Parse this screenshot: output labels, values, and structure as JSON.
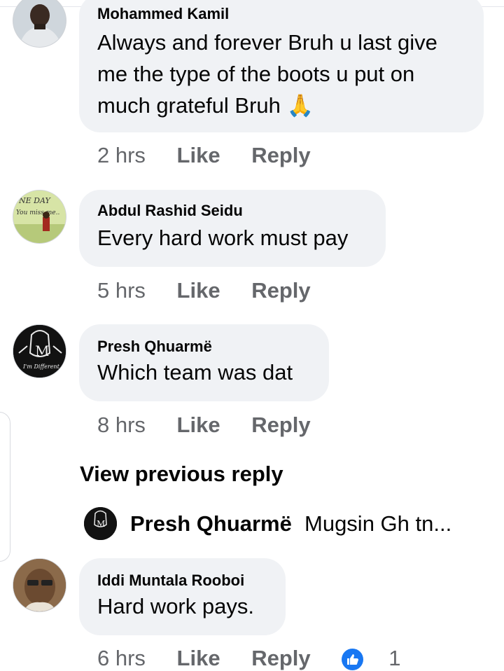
{
  "comments": [
    {
      "author": "Mohammed Kamil",
      "text": "Always and forever Bruh u last give me the type of the boots u put on much grateful Bruh 🙏",
      "time": "2 hrs",
      "like": "Like",
      "reply": "Reply"
    },
    {
      "author": "Abdul Rashid Seidu",
      "text": "Every hard work must pay",
      "time": "5 hrs",
      "like": "Like",
      "reply": "Reply",
      "avatar_text_1": "NE DAY",
      "avatar_text_2": "You miss me.."
    },
    {
      "author": "Presh Qhuarmë",
      "text": "Which team was dat",
      "time": "8 hrs",
      "like": "Like",
      "reply": "Reply",
      "avatar_text": "I'm Different"
    },
    {
      "author": "Iddi Muntala Rooboi",
      "text": "Hard work pays.",
      "time": "6 hrs",
      "like": "Like",
      "reply": "Reply",
      "reaction_count": "1"
    }
  ],
  "view_previous": "View previous reply",
  "reply_preview": {
    "author": "Presh Qhuarmë",
    "snippet": "Mugsin Gh tn..."
  },
  "colors": {
    "bubble": "#f0f2f5",
    "meta": "#65676b",
    "like_blue": "#1877f2"
  }
}
